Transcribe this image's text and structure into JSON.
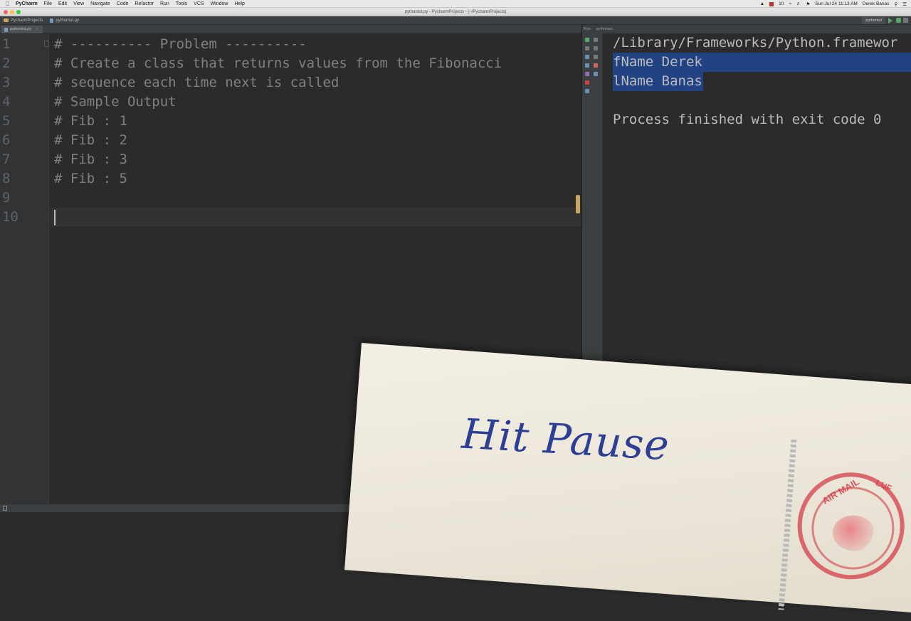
{
  "menubar": {
    "app_name": "PyCharm",
    "items": [
      "File",
      "Edit",
      "View",
      "Navigate",
      "Code",
      "Refactor",
      "Run",
      "Tools",
      "VCS",
      "Window",
      "Help"
    ],
    "status_badge": "10",
    "clock": "Sun Jul 24  11:13 AM",
    "user": "Derek Banas"
  },
  "window": {
    "title": "pythontut.py - PycharmProjects - [~/PycharmProjects]"
  },
  "navbar": {
    "project": "PycharmProjects",
    "file": "pythontut.py",
    "run_config": "pythontut"
  },
  "editor": {
    "tab": "pythontut.py",
    "line_numbers": [
      "1",
      "2",
      "3",
      "4",
      "5",
      "6",
      "7",
      "8",
      "9",
      "10"
    ],
    "lines": [
      "# ---------- Problem ----------",
      "# Create a class that returns values from the Fibonacci",
      "# sequence each time next is called",
      "# Sample Output",
      "# Fib : 1",
      "# Fib : 2",
      "# Fib : 3",
      "# Fib : 5",
      "",
      ""
    ]
  },
  "run_panel": {
    "label": "Run",
    "config": "pythontut",
    "console": [
      "/Library/Frameworks/Python.framewor",
      "fName Derek",
      "lName Banas",
      "",
      "Process finished with exit code 0"
    ]
  },
  "overlay": {
    "text": "Hit Pause",
    "postmark": "AIR MAIL",
    "postmark_2": "LUF"
  }
}
